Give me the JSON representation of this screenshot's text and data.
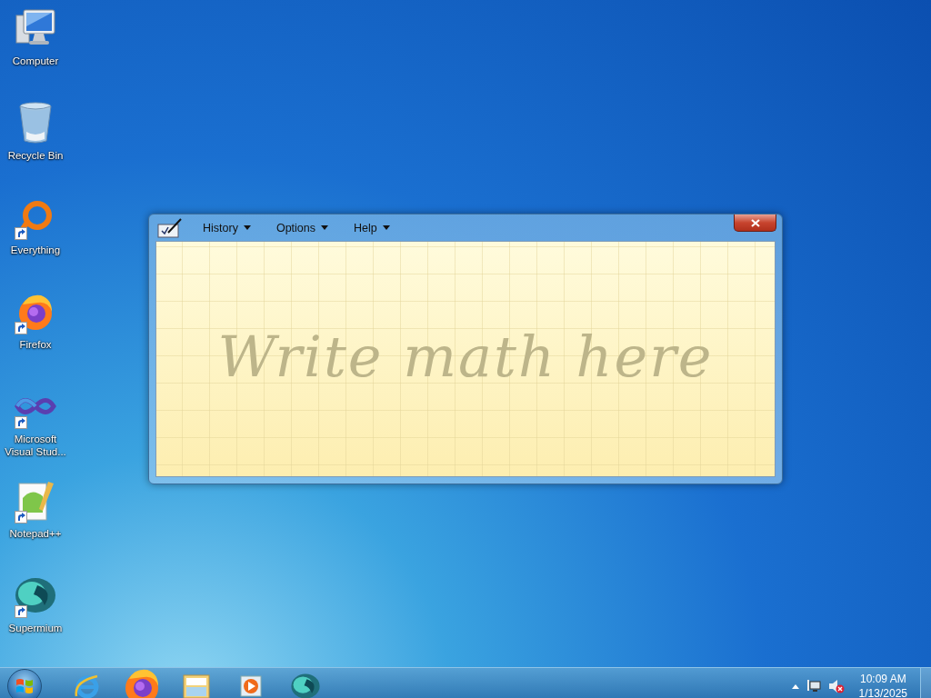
{
  "desktop_icons": [
    {
      "label": "Computer",
      "kind": "computer",
      "shortcut": false
    },
    {
      "label": "Recycle Bin",
      "kind": "recycle",
      "shortcut": false
    },
    {
      "label": "Everything",
      "kind": "ring",
      "shortcut": true
    },
    {
      "label": "Firefox",
      "kind": "firefox",
      "shortcut": true
    },
    {
      "label": "Microsoft Visual Stud...",
      "kind": "infinity",
      "shortcut": true
    },
    {
      "label": "Notepad++",
      "kind": "notepad",
      "shortcut": true
    },
    {
      "label": "Supermium",
      "kind": "supermium",
      "shortcut": true
    }
  ],
  "window": {
    "menus": [
      {
        "label": "History"
      },
      {
        "label": "Options"
      },
      {
        "label": "Help"
      }
    ],
    "placeholder": "Write math here"
  },
  "taskbar": {
    "pinned": [
      {
        "kind": "ie"
      },
      {
        "kind": "firefox"
      },
      {
        "kind": "folder"
      },
      {
        "kind": "player"
      },
      {
        "kind": "supermium"
      }
    ],
    "tray": {
      "muted": true,
      "time": "10:09 AM",
      "date": "1/13/2025"
    }
  }
}
